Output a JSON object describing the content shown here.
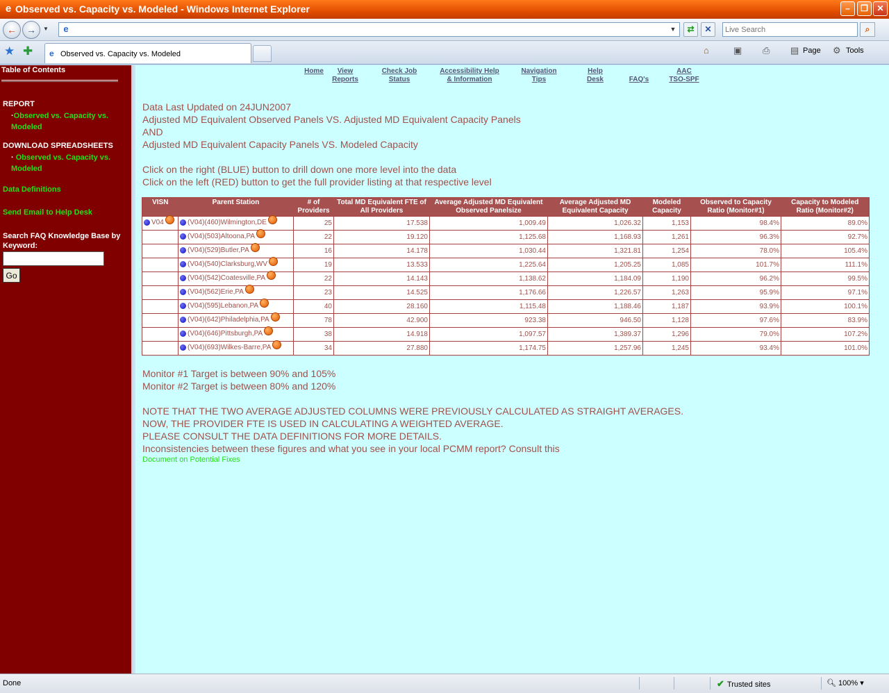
{
  "window": {
    "title": "Observed vs. Capacity vs. Modeled - Windows Internet Explorer"
  },
  "toolbar": {
    "address_value": "",
    "search_placeholder": "Live Search",
    "tab_title": "Observed vs. Capacity vs. Modeled",
    "page_label": "Page",
    "tools_label": "Tools"
  },
  "sidebar": {
    "toc_title": "Table of Contents",
    "report_heading": "REPORT",
    "report_link": "Observed vs. Capacity vs. Modeled",
    "download_heading": "DOWNLOAD SPREADSHEETS",
    "download_link": "Observed vs. Capacity vs. Modeled",
    "data_definitions": "Data Definitions",
    "send_email": "Send Email to Help Desk",
    "faq_label": "Search FAQ Knowledge Base by Keyword:",
    "faq_value": "",
    "go_label": "Go"
  },
  "topnav": [
    {
      "l1": "",
      "l2": "Home"
    },
    {
      "l1": "View",
      "l2": "Reports"
    },
    {
      "l1": "Check Job",
      "l2": "Status"
    },
    {
      "l1": "Accessibility Help",
      "l2": "& Information"
    },
    {
      "l1": "Navigation",
      "l2": "Tips"
    },
    {
      "l1": "Help",
      "l2": "Desk"
    },
    {
      "l1": "FAQ's",
      "l2": ""
    },
    {
      "l1": "AAC",
      "l2": "TSO-SPF"
    }
  ],
  "intro": {
    "updated": "Data Last Updated on 24JUN2007",
    "line1": "Adjusted MD Equivalent Observed Panels VS. Adjusted MD Equivalent Capacity Panels",
    "line2": "AND",
    "line3": "Adjusted MD Equivalent Capacity Panels VS. Modeled Capacity",
    "instr1": "Click on the right (BLUE) button to drill down one more level into the data",
    "instr2": "Click on the left (RED) button to get the full provider listing at that respective level"
  },
  "table": {
    "headers": [
      "VISN",
      "Parent Station",
      "# of Providers",
      "Total MD Equivalent FTE of All Providers",
      "Average Adjusted MD Equivalent Observed Panelsize",
      "Average Adjusted MD Equivalent Capacity",
      "Modeled Capacity",
      "Observed to Capacity Ratio (Monitor#1)",
      "Capacity to Modeled Ratio (Monitor#2)"
    ],
    "visn": "V04",
    "rows": [
      {
        "station": "(V04)(460)Wilmington,DE",
        "providers": "25",
        "fte": "17.538",
        "observed": "1,009.49",
        "capacity": "1,026.32",
        "modeled": "1,153",
        "ratio1": "98.4%",
        "ratio2": "89.0%",
        "r1class": "good",
        "r2class": "good"
      },
      {
        "station": "(V04)(503)Altoona,PA",
        "providers": "22",
        "fte": "19.120",
        "observed": "1,125.68",
        "capacity": "1,168.93",
        "modeled": "1,261",
        "ratio1": "96.3%",
        "ratio2": "92.7%",
        "r1class": "good",
        "r2class": "good"
      },
      {
        "station": "(V04)(529)Butler,PA",
        "providers": "16",
        "fte": "14.178",
        "observed": "1,030.44",
        "capacity": "1,321.81",
        "modeled": "1,254",
        "ratio1": "78.0%",
        "ratio2": "105.4%",
        "r1class": "low",
        "r2class": "good"
      },
      {
        "station": "(V04)(540)Clarksburg,WV",
        "providers": "19",
        "fte": "13.533",
        "observed": "1,225.64",
        "capacity": "1,205.25",
        "modeled": "1,085",
        "ratio1": "101.7%",
        "ratio2": "111.1%",
        "r1class": "good",
        "r2class": "good"
      },
      {
        "station": "(V04)(542)Coatesville,PA",
        "providers": "22",
        "fte": "14.143",
        "observed": "1,138.62",
        "capacity": "1,184.09",
        "modeled": "1,190",
        "ratio1": "96.2%",
        "ratio2": "99.5%",
        "r1class": "good",
        "r2class": "good"
      },
      {
        "station": "(V04)(562)Erie,PA",
        "providers": "23",
        "fte": "14.525",
        "observed": "1,176.66",
        "capacity": "1,226.57",
        "modeled": "1,263",
        "ratio1": "95.9%",
        "ratio2": "97.1%",
        "r1class": "good",
        "r2class": "good"
      },
      {
        "station": "(V04)(595)Lebanon,PA",
        "providers": "40",
        "fte": "28.160",
        "observed": "1,115.48",
        "capacity": "1,188.46",
        "modeled": "1,187",
        "ratio1": "93.9%",
        "ratio2": "100.1%",
        "r1class": "good",
        "r2class": "good"
      },
      {
        "station": "(V04)(642)Philadelphia,PA",
        "providers": "78",
        "fte": "42.900",
        "observed": "923.38",
        "capacity": "946.50",
        "modeled": "1,128",
        "ratio1": "97.6%",
        "ratio2": "83.9%",
        "r1class": "good",
        "r2class": "good"
      },
      {
        "station": "(V04)(646)Pittsburgh,PA",
        "providers": "38",
        "fte": "14.918",
        "observed": "1,097.57",
        "capacity": "1,389.37",
        "modeled": "1,296",
        "ratio1": "79.0%",
        "ratio2": "107.2%",
        "r1class": "low",
        "r2class": "good"
      },
      {
        "station": "(V04)(693)Wilkes-Barre,PA",
        "providers": "34",
        "fte": "27.880",
        "observed": "1,174.75",
        "capacity": "1,257.96",
        "modeled": "1,245",
        "ratio1": "93.4%",
        "ratio2": "101.0%",
        "r1class": "good",
        "r2class": "good"
      }
    ]
  },
  "notes": {
    "monitor1": "Monitor #1 Target is between 90% and 105%",
    "monitor2": "Monitor #2 Target is between 80% and 120%",
    "note1": "NOTE THAT THE TWO AVERAGE ADJUSTED COLUMNS WERE PREVIOUSLY CALCULATED AS STRAIGHT AVERAGES.",
    "note2": "NOW, THE PROVIDER FTE IS USED IN CALCULATING A WEIGHTED AVERAGE.",
    "note3": "PLEASE CONSULT THE DATA DEFINITIONS FOR MORE DETAILS.",
    "note4": "Inconsistencies between these figures and what you see in your local PCMM report? Consult this",
    "doc_link": "Document on Potential Fixes"
  },
  "status": {
    "done": "Done",
    "zone": "Trusted sites",
    "zoom": "100%"
  },
  "colors": {
    "sidebar_bg": "#800000",
    "content_bg": "#ccffff",
    "header_bg": "#a65050",
    "good_ratio": "#22cc22",
    "low_ratio": "#1a1ad0"
  }
}
